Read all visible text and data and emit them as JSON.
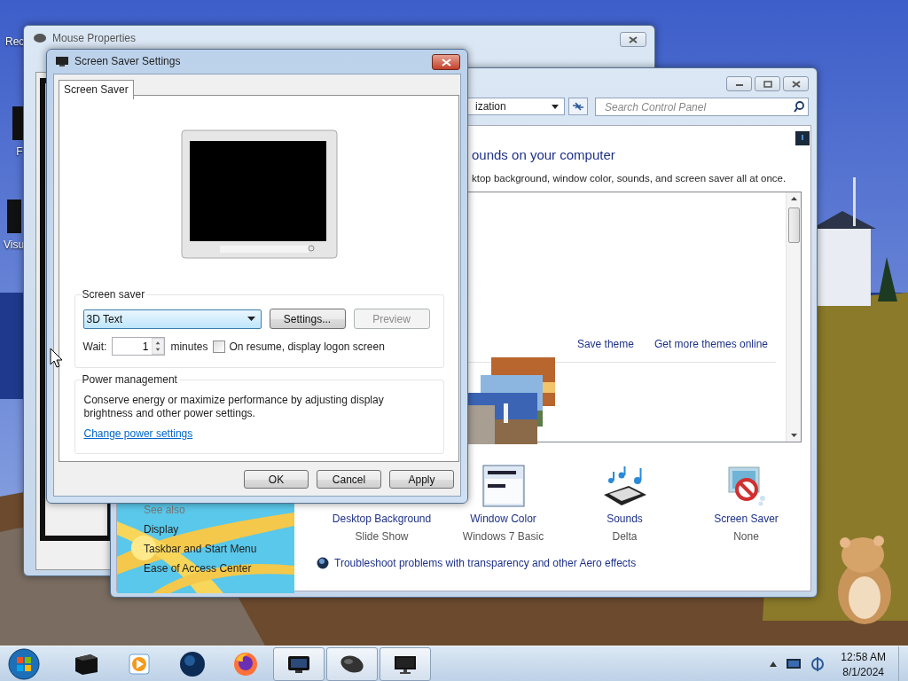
{
  "desktop": {
    "icons": [
      {
        "label": "Rec"
      },
      {
        "label": "F"
      },
      {
        "label": "Visu"
      }
    ]
  },
  "mouse_properties": {
    "title": "Mouse Properties"
  },
  "control_panel": {
    "address": "ization",
    "search": {
      "placeholder": "Search Control Panel"
    },
    "heading": "ounds on your computer",
    "description": "ktop background, window color, sounds, and screen saver all at once.",
    "theme_links": [
      "Save theme",
      "Get more themes online"
    ],
    "settings": [
      {
        "kind": "background",
        "label": "Desktop Background",
        "value": "Slide Show"
      },
      {
        "kind": "color",
        "label": "Window Color",
        "value": "Windows 7 Basic"
      },
      {
        "kind": "sounds",
        "label": "Sounds",
        "value": "Delta"
      },
      {
        "kind": "screensaver",
        "label": "Screen Saver",
        "value": "None"
      }
    ],
    "see_also": {
      "title": "See also",
      "links": [
        "Display",
        "Taskbar and Start Menu",
        "Ease of Access Center"
      ]
    },
    "troubleshoot": "Troubleshoot problems with transparency and other Aero effects"
  },
  "dialog": {
    "title": "Screen Saver Settings",
    "tabs": [
      {
        "label": "Screen Saver",
        "selected": true
      }
    ],
    "screen_saver": {
      "title": "Screen saver",
      "selected": "3D Text",
      "buttons": [
        {
          "label": "Settings...",
          "disabled": false
        },
        {
          "label": "Preview",
          "disabled": true
        }
      ],
      "wait_label": "Wait:",
      "wait_value": "1",
      "wait_unit": "minutes",
      "logon": {
        "label": "On resume, display logon screen",
        "checked": false
      }
    },
    "power": {
      "title": "Power management",
      "text": "Conserve energy or maximize performance by adjusting display brightness and other power settings.",
      "link": "Change power settings"
    },
    "buttons": [
      "OK",
      "Cancel",
      "Apply"
    ]
  },
  "taskbar": {
    "apps": [
      {
        "kind": "box",
        "running": false
      },
      {
        "kind": "media",
        "running": false
      },
      {
        "kind": "globe",
        "running": false
      },
      {
        "kind": "firefox",
        "running": false
      },
      {
        "kind": "display",
        "running": true
      },
      {
        "kind": "mouse",
        "running": true
      },
      {
        "kind": "monitor",
        "running": true
      }
    ],
    "time": "12:58 AM",
    "date": "8/1/2024"
  }
}
